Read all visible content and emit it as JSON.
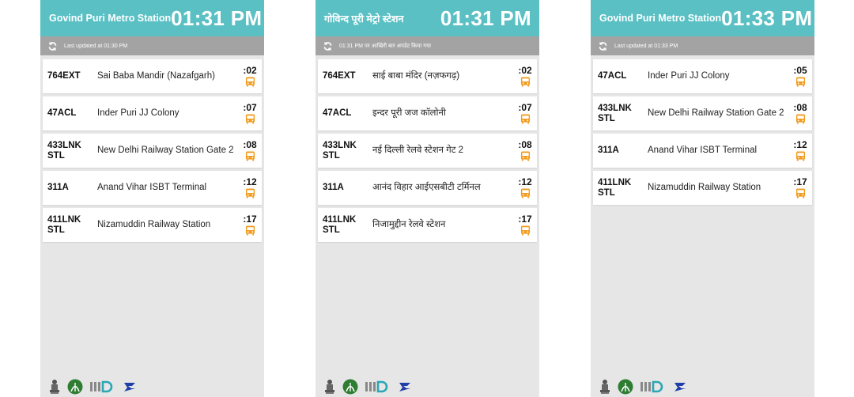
{
  "colors": {
    "header": "#5ac0c4",
    "update_bar": "#a3a3a3",
    "bus_icon": "#f29b1d",
    "background": "#e6e6e6"
  },
  "screens": [
    {
      "station": "Govind Puri Metro Station",
      "time": "01:31 PM",
      "updated": "Last updated at 01:30 PM",
      "rows": [
        {
          "route": "764EXT",
          "dest": "Sai Baba Mandir (Nazafgarh)",
          "eta": ":02"
        },
        {
          "route": "47ACL",
          "dest": "Inder Puri JJ Colony",
          "eta": ":07"
        },
        {
          "route": "433LNK STL",
          "dest": "New Delhi Railway Station Gate 2",
          "eta": ":08"
        },
        {
          "route": "311A",
          "dest": "Anand Vihar ISBT Terminal",
          "eta": ":12"
        },
        {
          "route": "411LNK STL",
          "dest": "Nizamuddin Railway Station",
          "eta": ":17"
        }
      ]
    },
    {
      "station": "गोविन्द पूरी मेट्रो स्टेशन",
      "time": "01:31 PM",
      "updated": "01:31 PM पर आखिरी बार अपडेट किया गया",
      "rows": [
        {
          "route": "764EXT",
          "dest": "साई बाबा मंदिर (नज़फगढ़)",
          "eta": ":02"
        },
        {
          "route": "47ACL",
          "dest": "इन्दर पूरी जज कॉलोनी",
          "eta": ":07"
        },
        {
          "route": "433LNK STL",
          "dest": "नई दिल्ली रेलवे स्टेशन गेट 2",
          "eta": ":08"
        },
        {
          "route": "311A",
          "dest": "आनंद विहार आईएसबीटी टर्मिनल",
          "eta": ":12"
        },
        {
          "route": "411LNK STL",
          "dest": "निजामुद्दीन रेलवे स्टेशन",
          "eta": ":17"
        }
      ]
    },
    {
      "station": "Govind Puri Metro Station",
      "time": "01:33 PM",
      "updated": "Last updated at 01:33 PM",
      "rows": [
        {
          "route": "47ACL",
          "dest": "Inder Puri JJ Colony",
          "eta": ":05"
        },
        {
          "route": "433LNK STL",
          "dest": "New Delhi Railway Station Gate 2",
          "eta": ":08"
        },
        {
          "route": "311A",
          "dest": "Anand Vihar ISBT Terminal",
          "eta": ":12"
        },
        {
          "route": "411LNK STL",
          "dest": "Nizamuddin Railway Station",
          "eta": ":17"
        }
      ]
    }
  ],
  "footer_logos": [
    "emblem-logo",
    "dimts-logo",
    "iiitd-logo",
    "transport-logo"
  ]
}
